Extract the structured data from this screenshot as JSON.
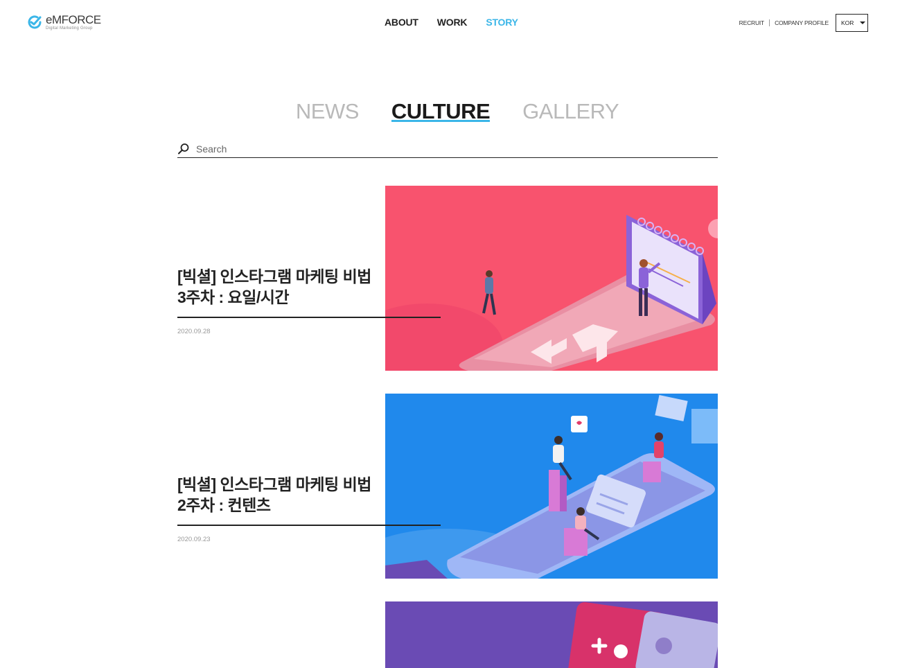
{
  "header": {
    "logo": {
      "name": "eMFORCE",
      "tagline": "Digital Marketing Group"
    },
    "nav": [
      {
        "label": "ABOUT",
        "active": false
      },
      {
        "label": "WORK",
        "active": false
      },
      {
        "label": "STORY",
        "active": true
      }
    ],
    "util_links": [
      "RECRUIT",
      "COMPANY PROFILE"
    ],
    "language": "KOR"
  },
  "tabs": [
    {
      "label": "NEWS",
      "active": false
    },
    {
      "label": "CULTURE",
      "active": true
    },
    {
      "label": "GALLERY",
      "active": false
    }
  ],
  "search": {
    "placeholder": "Search",
    "value": ""
  },
  "posts": [
    {
      "title_line1": "[빅셜] 인스타그램 마케팅 비법",
      "title_line2": "3주차 : 요일/시간",
      "date": "2020.09.28",
      "image_color": "#f8536e"
    },
    {
      "title_line1": "[빅셜] 인스타그램 마케팅 비법",
      "title_line2": "2주차 : 컨텐츠",
      "date": "2020.09.23",
      "image_color": "#2089ec"
    },
    {
      "title_line1": "",
      "title_line2": "",
      "date": "",
      "image_color": "#6a4bb4"
    }
  ],
  "colors": {
    "accent": "#3bb6e8",
    "text": "#222222",
    "muted": "#b9b9b9"
  }
}
